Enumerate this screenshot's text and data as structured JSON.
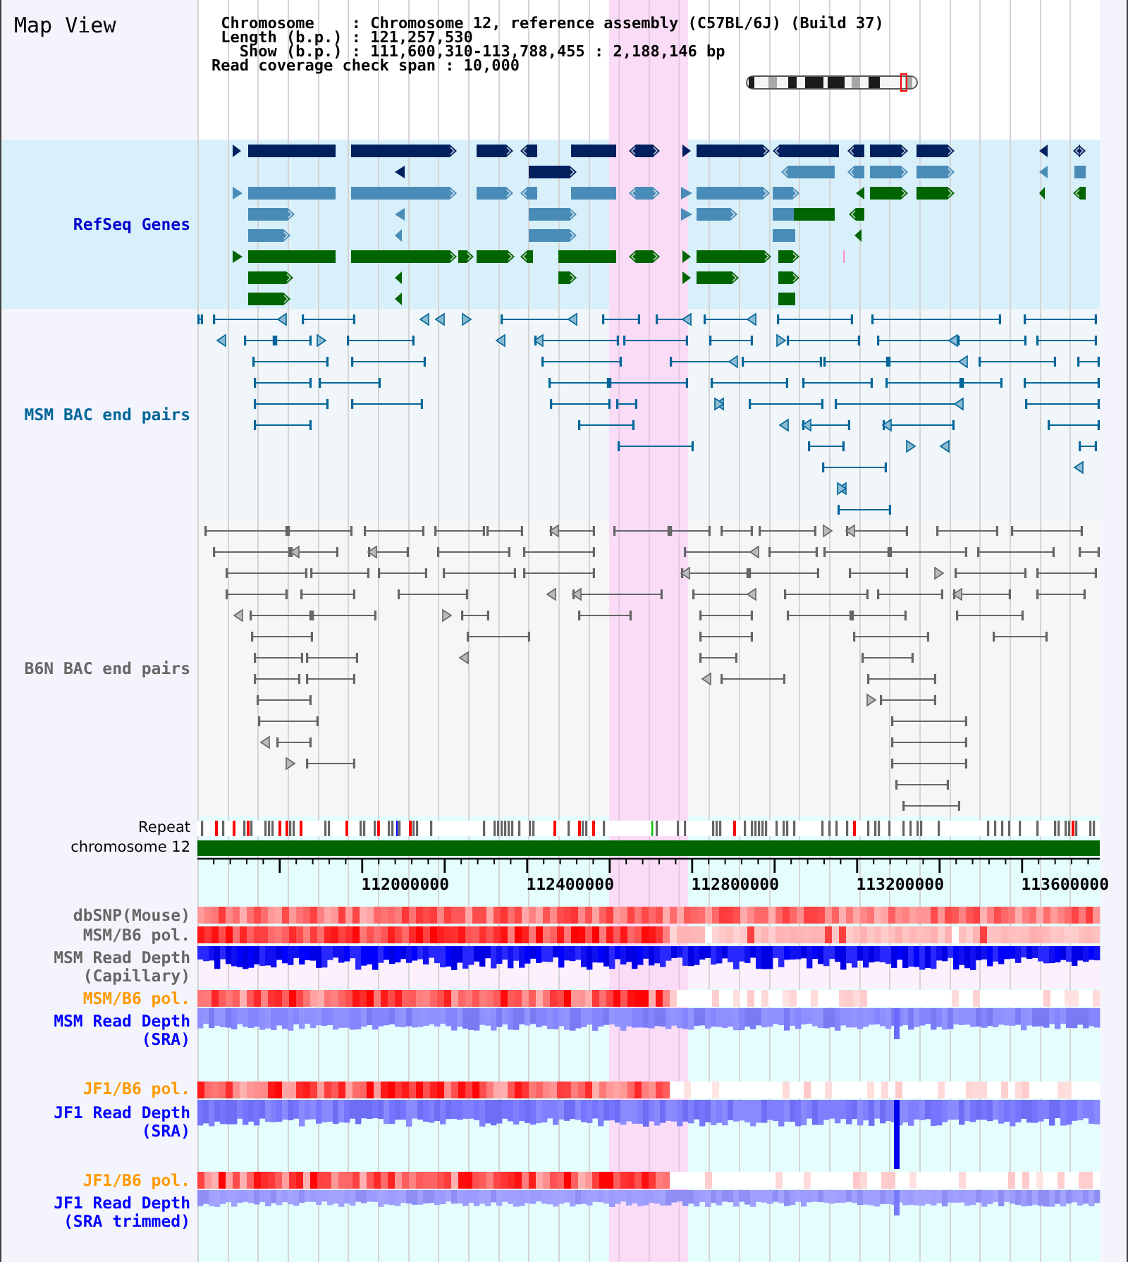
{
  "title": "Map View",
  "info": {
    "lines": [
      "Chromosome    : Chromosome 12, reference assembly (C57BL/6J) (Build 37)",
      "Length (b.p.) : 121,257,530",
      "  Show (b.p.) : 111,600,310-113,788,455 : 2,188,146 bp"
    ],
    "span_line": "Read coverage check span : 10,000"
  },
  "tracks": [
    {
      "kind": "genes",
      "label": "RefSeq Genes",
      "color": "#0000cc"
    },
    {
      "kind": "pairs",
      "label": "MSM BAC end pairs",
      "color": "#006699"
    },
    {
      "kind": "pairs",
      "label": "B6N BAC end pairs",
      "color": "#666666"
    },
    {
      "kind": "repeat",
      "label": "Repeat",
      "color": "#000000"
    },
    {
      "kind": "chromosome",
      "label": "chromosome 12",
      "color": "#000000"
    },
    {
      "kind": "axis",
      "ticks": [
        "112000000",
        "112400000",
        "112800000",
        "113200000",
        "113600000"
      ]
    },
    {
      "kind": "heatmap",
      "label": "dbSNP(Mouse)",
      "color": "#666666"
    },
    {
      "kind": "heatmap",
      "label": "MSM/B6 pol.",
      "color": "#666666"
    },
    {
      "kind": "capillary",
      "label": "MSM Read Depth (Capillary)",
      "color": "#666666"
    },
    {
      "kind": "heatmap",
      "label": "MSM/B6 pol.",
      "color": "#ff9900"
    },
    {
      "kind": "depth",
      "label": "MSM Read Depth (SRA)",
      "color": "#0000ff"
    },
    {
      "kind": "heatmap",
      "label": "JF1/B6 pol.",
      "color": "#ff9900"
    },
    {
      "kind": "depth",
      "label": "JF1 Read Depth (SRA)",
      "color": "#0000ff"
    },
    {
      "kind": "heatmap",
      "label": "JF1/B6 pol.",
      "color": "#ff9900"
    },
    {
      "kind": "depth",
      "label": "JF1 Read Depth (SRA trimmed)",
      "color": "#0000ff"
    }
  ]
}
